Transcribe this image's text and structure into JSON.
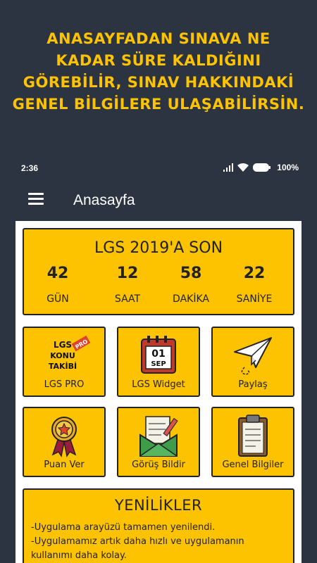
{
  "promo": {
    "lines": [
      "ANASAYFADAN SINAVA NE",
      "KADAR SÜRE KALDIĞINI",
      "GÖREBİLİR, SINAV HAKKINDAKİ",
      "GENEL BİLGİLERE ULAŞABİLİRSİN."
    ]
  },
  "status": {
    "time": "2:36",
    "battery": "100%"
  },
  "appbar": {
    "title": "Anasayfa",
    "menu_icon": "hamburger-menu-icon"
  },
  "countdown": {
    "title": "LGS 2019'A SON",
    "units": [
      {
        "value": "42",
        "label": "GÜN"
      },
      {
        "value": "12",
        "label": "SAAT"
      },
      {
        "value": "58",
        "label": "DAKİKA"
      },
      {
        "value": "22",
        "label": "SANİYE"
      }
    ]
  },
  "tiles": [
    {
      "label": "LGS PRO",
      "icon": "lgs-konu-takibi-logo",
      "logo_text": [
        "LGS",
        "KONU",
        "TAKİBİ"
      ],
      "badge": "PRO"
    },
    {
      "label": "LGS Widget",
      "icon": "calendar-icon",
      "cal_day": "01",
      "cal_month": "SEP"
    },
    {
      "label": "Paylaş",
      "icon": "paper-plane-icon"
    },
    {
      "label": "Puan Ver",
      "icon": "medal-icon"
    },
    {
      "label": "Görüş Bildir",
      "icon": "letter-envelope-icon"
    },
    {
      "label": "Genel Bilgiler",
      "icon": "clipboard-icon"
    }
  ],
  "news": {
    "title": "YENİLİKLER",
    "items": [
      "-Uygulama arayüzü tamamen yenilendi.",
      "-Uygulamamız artık daha hızlı ve uygulamanın",
      "kullanımı daha kolay."
    ]
  },
  "colors": {
    "background": "#2c3442",
    "accent": "#fdc300"
  }
}
